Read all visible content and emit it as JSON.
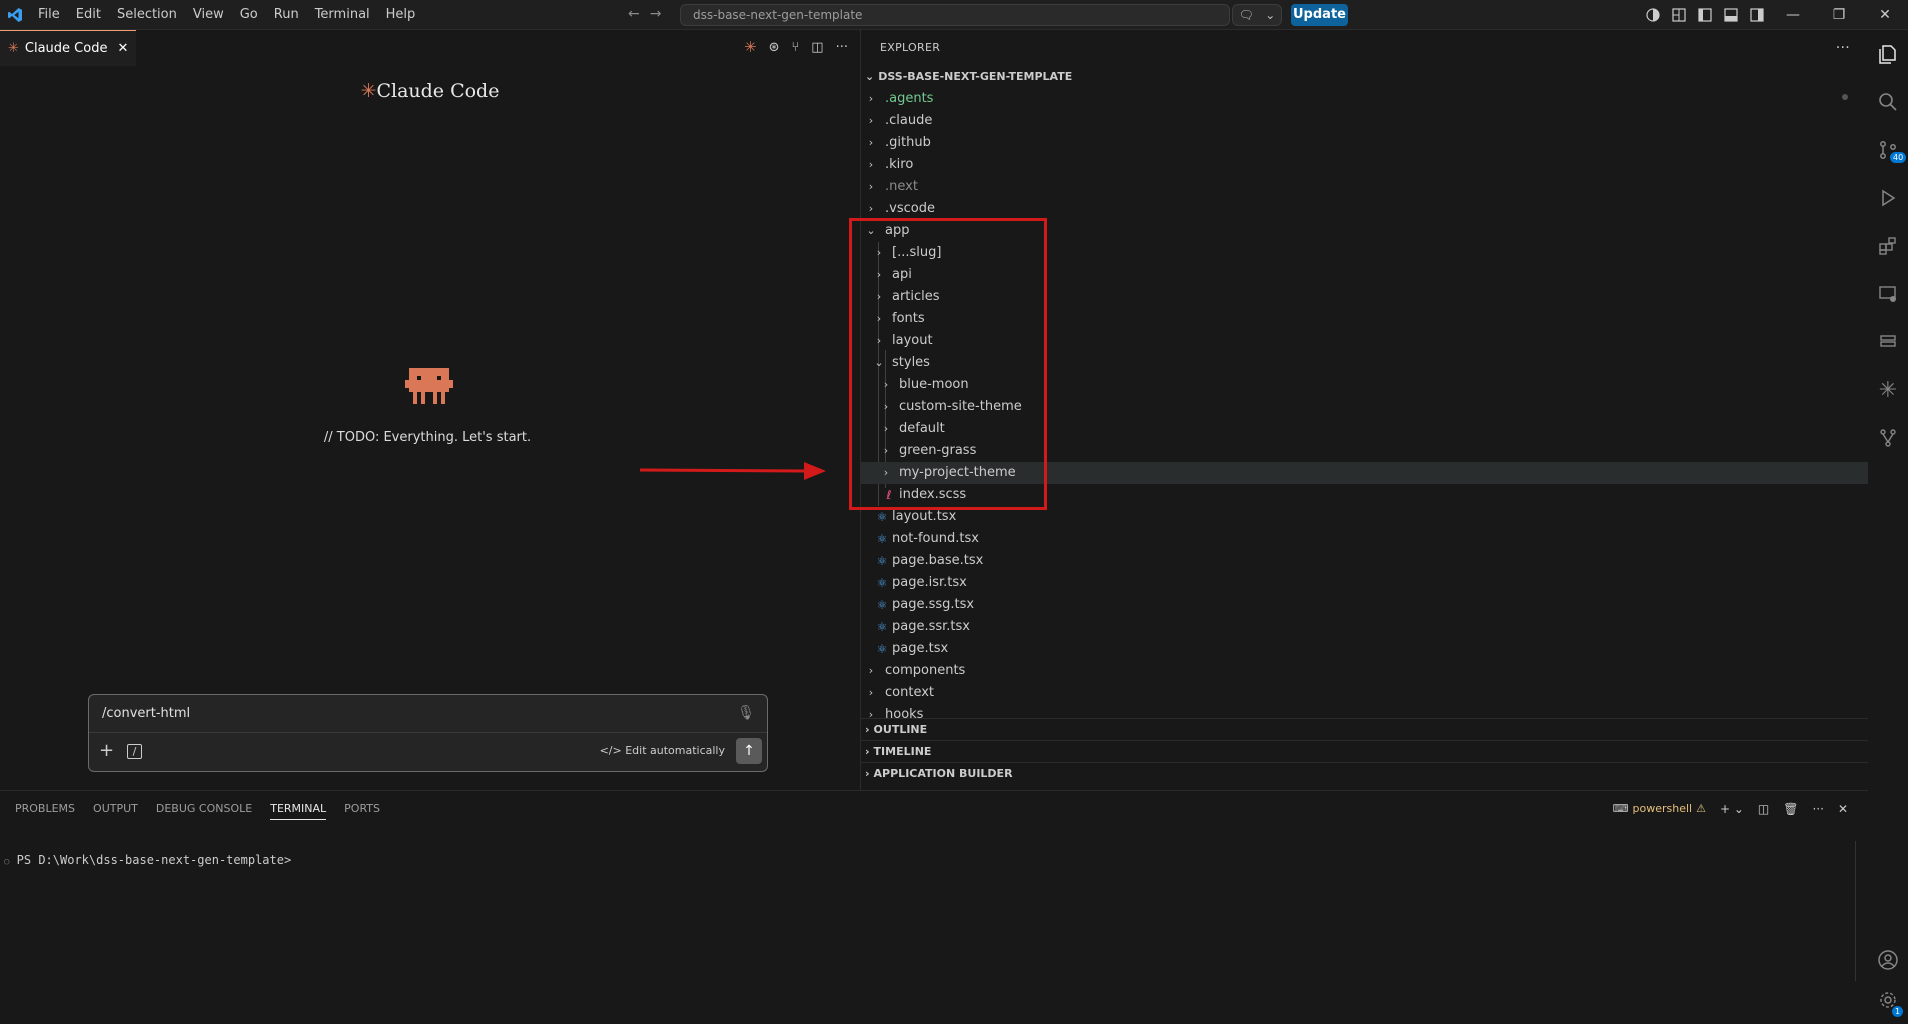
{
  "menu": [
    "File",
    "Edit",
    "Selection",
    "View",
    "Go",
    "Run",
    "Terminal",
    "Help"
  ],
  "search": {
    "value": "dss-base-next-gen-template"
  },
  "update_label": "Update",
  "editor": {
    "tab_label": "Claude Code",
    "brand_title": "Claude Code",
    "todo_text": "// TODO: Everything. Let's start.",
    "chat": {
      "input_value": "/convert-html",
      "edit_mode_label": "Edit automatically"
    }
  },
  "explorer": {
    "header": "EXPLORER",
    "root": "DSS-BASE-NEXT-GEN-TEMPLATE",
    "items": [
      {
        "label": ".agents",
        "color": "#73c991"
      },
      {
        "label": ".claude"
      },
      {
        "label": ".github"
      },
      {
        "label": ".kiro"
      },
      {
        "label": ".next",
        "color": "#8b8b8b"
      },
      {
        "label": ".vscode"
      },
      {
        "label": "app"
      },
      {
        "label": "[...slug]"
      },
      {
        "label": "api"
      },
      {
        "label": "articles"
      },
      {
        "label": "fonts"
      },
      {
        "label": "layout"
      },
      {
        "label": "styles"
      },
      {
        "label": "blue-moon"
      },
      {
        "label": "custom-site-theme"
      },
      {
        "label": "default"
      },
      {
        "label": "green-grass"
      },
      {
        "label": "my-project-theme"
      },
      {
        "label": "index.scss"
      },
      {
        "label": "layout.tsx"
      },
      {
        "label": "not-found.tsx"
      },
      {
        "label": "page.base.tsx"
      },
      {
        "label": "page.isr.tsx"
      },
      {
        "label": "page.ssg.tsx"
      },
      {
        "label": "page.ssr.tsx"
      },
      {
        "label": "page.tsx"
      },
      {
        "label": "components"
      },
      {
        "label": "context"
      },
      {
        "label": "hooks"
      }
    ],
    "sections": [
      "OUTLINE",
      "TIMELINE",
      "APPLICATION BUILDER"
    ]
  },
  "activity": {
    "source_control_badge": "40",
    "settings_badge": "1"
  },
  "panel": {
    "tabs": [
      "PROBLEMS",
      "OUTPUT",
      "DEBUG CONSOLE",
      "TERMINAL",
      "PORTS"
    ],
    "active_tab": "TERMINAL",
    "shell_label": "powershell",
    "prompt": "PS D:\\Work\\dss-base-next-gen-template>"
  },
  "colors": {
    "accent": "#d97757",
    "highlight_box": "#d31a1a",
    "update_button": "#0e639c"
  }
}
